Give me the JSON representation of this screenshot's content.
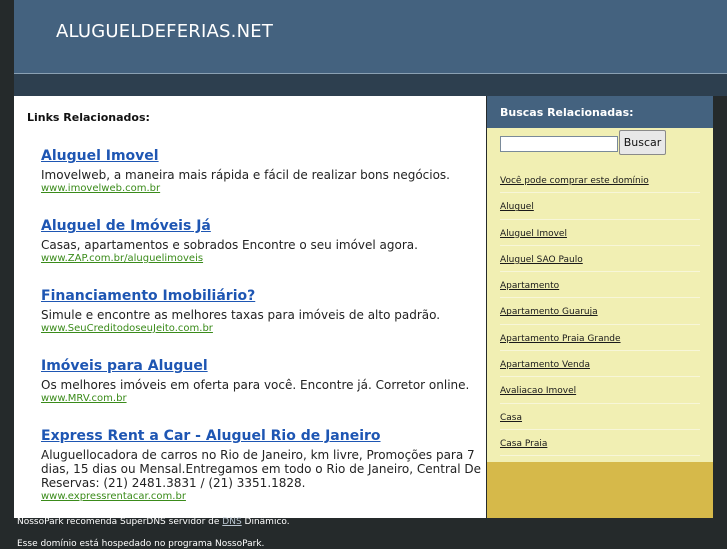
{
  "header": {
    "title": "ALUGUELDEFERIAS.NET"
  },
  "main": {
    "links_title": "Links Relacionados:",
    "ads": [
      {
        "title": "Aluguel Imovel",
        "desc": "Imovelweb, a maneira mais rápida e fácil de realizar bons negócios.",
        "url": "www.imovelweb.com.br"
      },
      {
        "title": "Aluguel de Imóveis Já",
        "desc": "Casas, apartamentos e sobrados Encontre o seu imóvel agora.",
        "url": "www.ZAP.com.br/aluguelimoveis"
      },
      {
        "title": "Financiamento Imobiliário?",
        "desc": "Simule e encontre as melhores taxas para imóveis de alto padrão.",
        "url": "www.SeuCreditodoseuJeito.com.br"
      },
      {
        "title": "Imóveis para Aluguel",
        "desc": "Os melhores imóveis em oferta para você. Encontre já. Corretor online.",
        "url": "www.MRV.com.br"
      },
      {
        "title": "Express Rent a Car - Aluguel Rio de Janeiro",
        "desc": "Aluguellocadora de carros no Rio de Janeiro, km livre, Promoções para 7 dias, 15 dias ou Mensal.Entregamos em todo o Rio de Janeiro, Central De Reservas: (21) 2481.3831 / (21) 3351.1828.",
        "url": "www.expressrentacar.com.br"
      }
    ]
  },
  "sidebar": {
    "title": "Buscas Relacionadas:",
    "search_value": "",
    "search_button": "Buscar",
    "items": [
      "Você pode comprar este domínio",
      "Aluguel",
      "Aluguel Imovel",
      "Aluguel SAO Paulo",
      "Apartamento",
      "Apartamento Guaruja",
      "Apartamento Praia Grande",
      "Apartamento Venda",
      "Avaliacao Imovel",
      "Casa",
      "Casa Praia"
    ]
  },
  "footer": {
    "line1_pre": "NossoPark recomenda SuperDNS servidor de ",
    "line1_link": "DNS",
    "line1_post": " Dinâmico.",
    "line2": "Esse domínio está hospedado no programa NossoPark."
  }
}
